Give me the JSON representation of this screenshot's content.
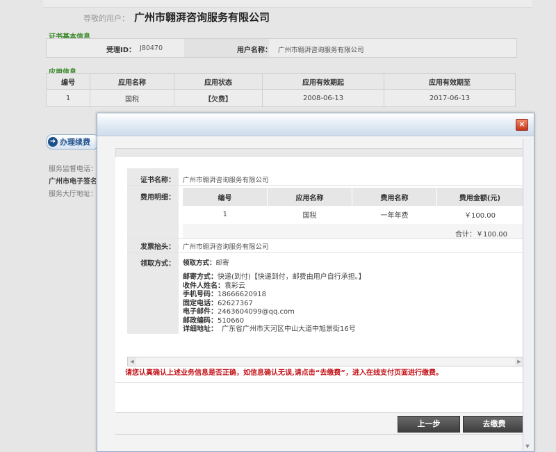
{
  "header": {
    "greeting_label": "尊敬的用户：",
    "company_name": "广州市翱湃咨询服务有限公司"
  },
  "cert_info": {
    "section_title": "证书基本信息",
    "accept_id_label": "受理ID：",
    "accept_id_value": "J80470",
    "user_name_label": "用户名称：",
    "user_name_value": "广州市翱湃咨询服务有限公司"
  },
  "app_info": {
    "section_title": "应用信息",
    "columns": [
      "编号",
      "应用名称",
      "应用状态",
      "应用有效期起",
      "应用有效期至"
    ],
    "rows": [
      {
        "no": "1",
        "name": "国税",
        "status": "【欠费】",
        "start": "2008-06-13",
        "end": "2017-06-13"
      }
    ]
  },
  "renew_button": {
    "label": "办理续费",
    "icon": "arrow-right-circle-icon"
  },
  "side_info": {
    "service_phone": "服务监督电话：",
    "e_sign": "广州市电子签名",
    "hall_address": "服务大厅地址："
  },
  "modal": {
    "close_icon": "close-icon",
    "cert_name_label": "证书名称：",
    "cert_name_value": "广州市翱湃咨询服务有限公司",
    "fee_detail_label": "费用明细：",
    "fee_columns": [
      "编号",
      "应用名称",
      "费用名称",
      "费用金额(元)"
    ],
    "fee_rows": [
      {
        "no": "1",
        "app": "国税",
        "fee_name": "一年年费",
        "amount": "￥100.00"
      }
    ],
    "fee_total": "合计：￥100.00",
    "invoice_label": "发票抬头：",
    "invoice_value": "广州市翱湃咨询服务有限公司",
    "pickup_label": "领取方式：",
    "pickup_method_label": "领取方式：",
    "pickup_method_value": "邮寄",
    "mail_method_label": "邮寄方式：",
    "mail_method_value": "快递(到付)【快递到付，邮费由用户自行承担。】",
    "recipient_label": "收件人姓名：",
    "recipient_value": "袁彩云",
    "mobile_label": "手机号码：",
    "mobile_value": "18666620918",
    "phone_label": "固定电话：",
    "phone_value": "62627367",
    "email_label": "电子邮件：",
    "email_value": "2463604099@qq.com",
    "postcode_label": "邮政编码：",
    "postcode_value": "510660",
    "address_label": "详细地址：",
    "address_value": "广东省广州市天河区中山大道中旭景街16号",
    "warning": "请您认真确认上述业务信息是否正确，如信息确认无误,请点击“去缴费”，进入在线支付页面进行缴费。",
    "prev_button": "上一步",
    "pay_button": "去缴费"
  },
  "colors": {
    "section_green": "#3a8a2a",
    "warning_red": "#c4161c",
    "button_dark": "#4a4a4a"
  }
}
